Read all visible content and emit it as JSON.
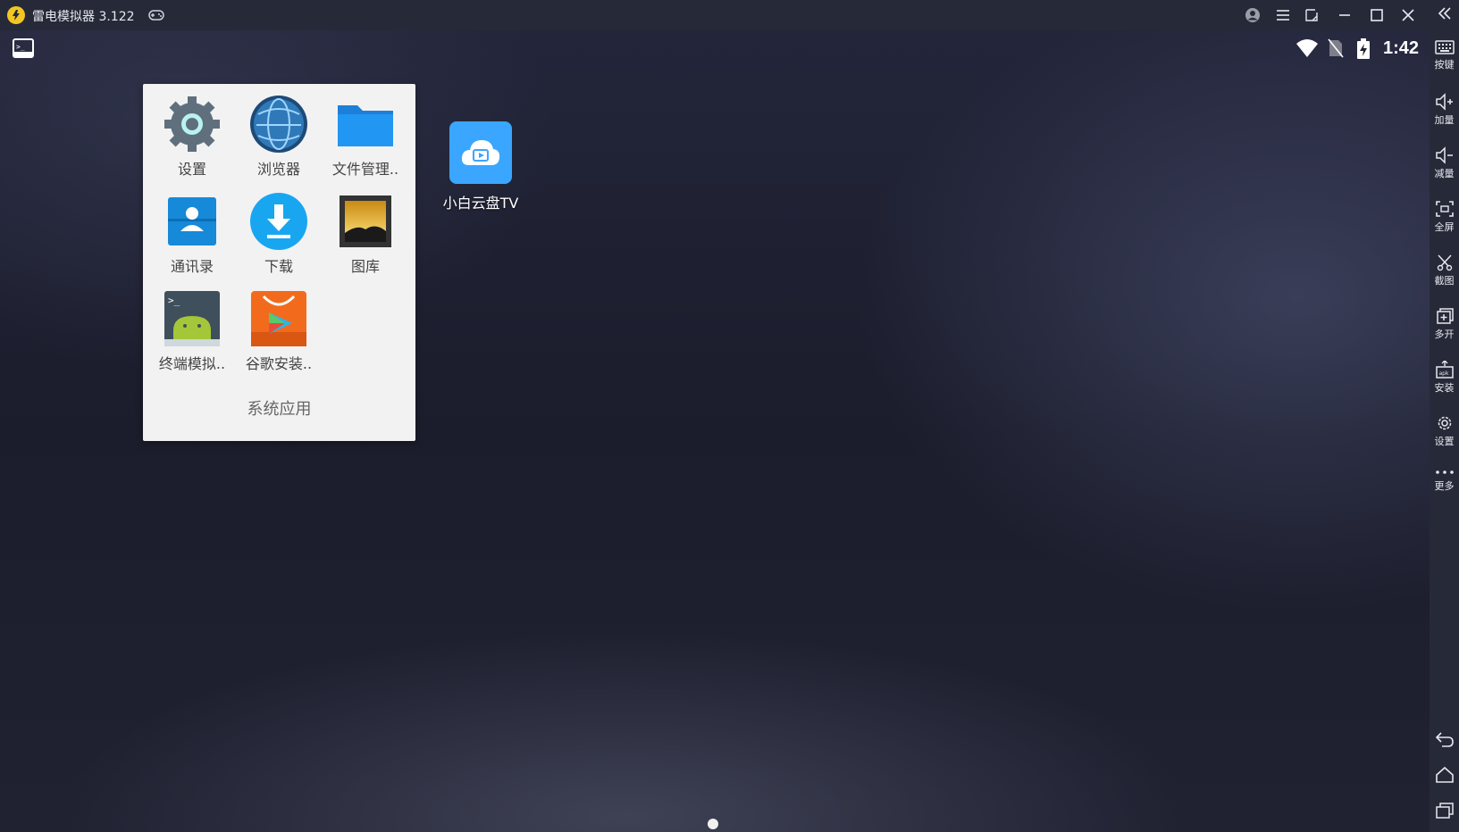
{
  "window": {
    "title": "雷电模拟器 3.122"
  },
  "status_bar": {
    "time": "1:42"
  },
  "folder": {
    "title": "系统应用",
    "apps": [
      {
        "label": "设置",
        "icon": "settings-icon"
      },
      {
        "label": "浏览器",
        "icon": "browser-icon"
      },
      {
        "label": "文件管理..",
        "icon": "folder-icon"
      },
      {
        "label": "通讯录",
        "icon": "contacts-icon"
      },
      {
        "label": "下载",
        "icon": "download-icon"
      },
      {
        "label": "图库",
        "icon": "gallery-icon"
      },
      {
        "label": "终端模拟..",
        "icon": "terminal-icon"
      },
      {
        "label": "谷歌安装..",
        "icon": "google-installer-icon"
      }
    ]
  },
  "desktop": {
    "apps": [
      {
        "label": "小白云盘TV",
        "icon": "cloud-tv-icon"
      }
    ]
  },
  "sidebar": {
    "items": [
      {
        "label": "按键",
        "icon": "keyboard-icon"
      },
      {
        "label": "加量",
        "icon": "volume-up-icon"
      },
      {
        "label": "减量",
        "icon": "volume-down-icon"
      },
      {
        "label": "全屏",
        "icon": "fullscreen-icon"
      },
      {
        "label": "截图",
        "icon": "scissors-icon"
      },
      {
        "label": "多开",
        "icon": "multi-instance-icon"
      },
      {
        "label": "安装",
        "icon": "apk-install-icon"
      },
      {
        "label": "设置",
        "icon": "gear-icon"
      },
      {
        "label": "更多",
        "icon": "more-icon"
      }
    ]
  },
  "colors": {
    "titlebar": "#262938",
    "accent_yellow": "#f3c623",
    "cloud_app": "#3aa6ff"
  }
}
